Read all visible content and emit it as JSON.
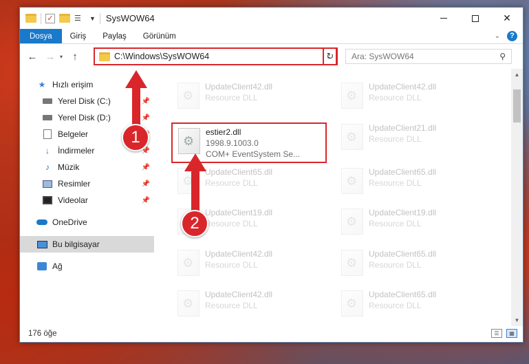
{
  "window": {
    "title": "SysWOW64",
    "controls": {
      "minimize": "minimize-icon",
      "maximize": "maximize-icon",
      "close": "✕"
    }
  },
  "ribbon": {
    "tabs": [
      "Dosya",
      "Giriş",
      "Paylaş",
      "Görünüm"
    ],
    "active_tab": "Dosya",
    "help": "?"
  },
  "nav": {
    "back": "←",
    "forward": "→",
    "recent": "▾",
    "up": "↑",
    "address": "C:\\Windows\\SysWOW64",
    "refresh": "↻",
    "search_placeholder": "Ara: SysWOW64"
  },
  "sidebar": {
    "items": [
      {
        "label": "Hızlı erişim",
        "icon": "star-icon"
      },
      {
        "label": "Yerel Disk (C:)",
        "icon": "drive-icon",
        "pinned": true
      },
      {
        "label": "Yerel Disk (D:)",
        "icon": "drive-icon",
        "pinned": true
      },
      {
        "label": "Belgeler",
        "icon": "documents-icon",
        "pinned": true
      },
      {
        "label": "İndirmeler",
        "icon": "downloads-icon",
        "pinned": true
      },
      {
        "label": "Müzik",
        "icon": "music-icon",
        "pinned": true
      },
      {
        "label": "Resimler",
        "icon": "pictures-icon",
        "pinned": true
      },
      {
        "label": "Videolar",
        "icon": "videos-icon",
        "pinned": true
      },
      {
        "label": "OneDrive",
        "icon": "onedrive-icon"
      },
      {
        "label": "Bu bilgisayar",
        "icon": "this-pc-icon",
        "selected": true
      },
      {
        "label": "Ağ",
        "icon": "network-icon"
      }
    ]
  },
  "files": {
    "selected": {
      "name": "estier2.dll",
      "version": "1998.9.1003.0",
      "desc": "COM+ EventSystem Se..."
    },
    "left_col": [
      {
        "name": "UpdateClient42.dll",
        "desc": "Resource DLL"
      },
      {
        "name": "UpdateClient65.dll",
        "desc": "Resource DLL"
      },
      {
        "name": "UpdateClient19.dll",
        "desc": "Resource DLL"
      },
      {
        "name": "UpdateClient42.dll",
        "desc": "Resource DLL"
      },
      {
        "name": "UpdateClient42.dll",
        "desc": "Resource DLL"
      }
    ],
    "right_col": [
      {
        "name": "UpdateClient42.dll",
        "desc": "Resource DLL"
      },
      {
        "name": "UpdateClient21.dll",
        "desc": "Resource DLL"
      },
      {
        "name": "UpdateClient65.dll",
        "desc": "Resource DLL"
      },
      {
        "name": "UpdateClient19.dll",
        "desc": "Resource DLL"
      },
      {
        "name": "UpdateClient65.dll",
        "desc": "Resource DLL"
      },
      {
        "name": "UpdateClient65.dll",
        "desc": "Resource DLL"
      }
    ]
  },
  "status": {
    "count": "176 öğe"
  },
  "annotations": {
    "step1": "1",
    "step2": "2",
    "color": "#d9262b"
  }
}
